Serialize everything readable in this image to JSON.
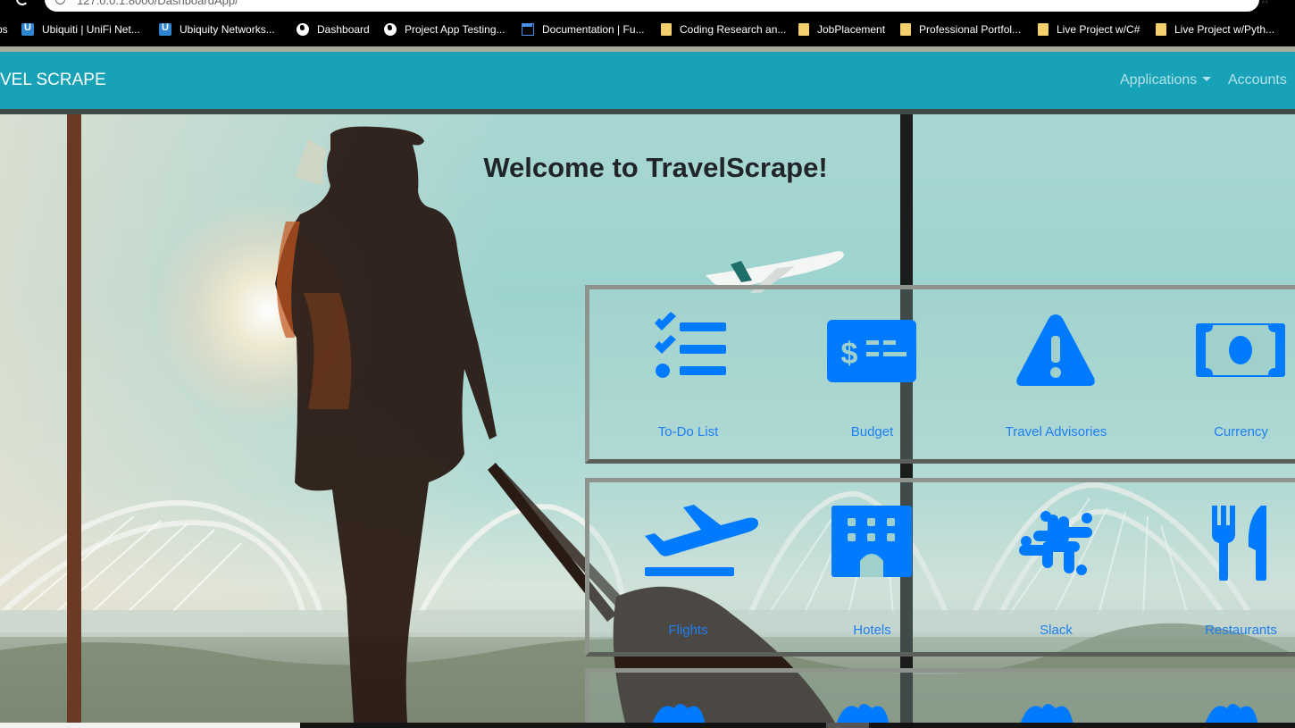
{
  "browser": {
    "url": "127.0.0.1:8000/DashboardApp/",
    "bookmarks": [
      {
        "label": "ps",
        "icon": "none"
      },
      {
        "label": "Ubiquiti | UniFi Net...",
        "icon": "unifi-icon"
      },
      {
        "label": "Ubiquity Networks...",
        "icon": "unifi-icon"
      },
      {
        "label": "Dashboard",
        "icon": "globe-icon"
      },
      {
        "label": "Project App Testing...",
        "icon": "globe-icon"
      },
      {
        "label": "Documentation | Fu...",
        "icon": "document-icon"
      },
      {
        "label": "Coding Research an...",
        "icon": "folder-icon"
      },
      {
        "label": "JobPlacement",
        "icon": "folder-icon"
      },
      {
        "label": "Professional Portfol...",
        "icon": "folder-icon"
      },
      {
        "label": "Live Project w/C#",
        "icon": "folder-icon"
      },
      {
        "label": "Live Project w/Pyth...",
        "icon": "folder-icon"
      }
    ]
  },
  "navbar": {
    "brand": "VEL SCRAPE",
    "applications": "Applications",
    "accounts": "Accounts",
    "color": "#17a2b8"
  },
  "hero": {
    "heading": "Welcome to TravelScrape!"
  },
  "tiles": {
    "accent": "#007bff",
    "row1": [
      {
        "label": "To-Do List",
        "icon": "tasks-icon"
      },
      {
        "label": "Budget",
        "icon": "money-check-icon"
      },
      {
        "label": "Travel Advisories",
        "icon": "warning-icon"
      },
      {
        "label": "Currency",
        "icon": "money-bill-icon"
      }
    ],
    "row2": [
      {
        "label": "Flights",
        "icon": "plane-departure-icon"
      },
      {
        "label": "Hotels",
        "icon": "hotel-icon"
      },
      {
        "label": "Slack",
        "icon": "slack-icon"
      },
      {
        "label": "Restaurants",
        "icon": "utensils-icon"
      }
    ]
  }
}
